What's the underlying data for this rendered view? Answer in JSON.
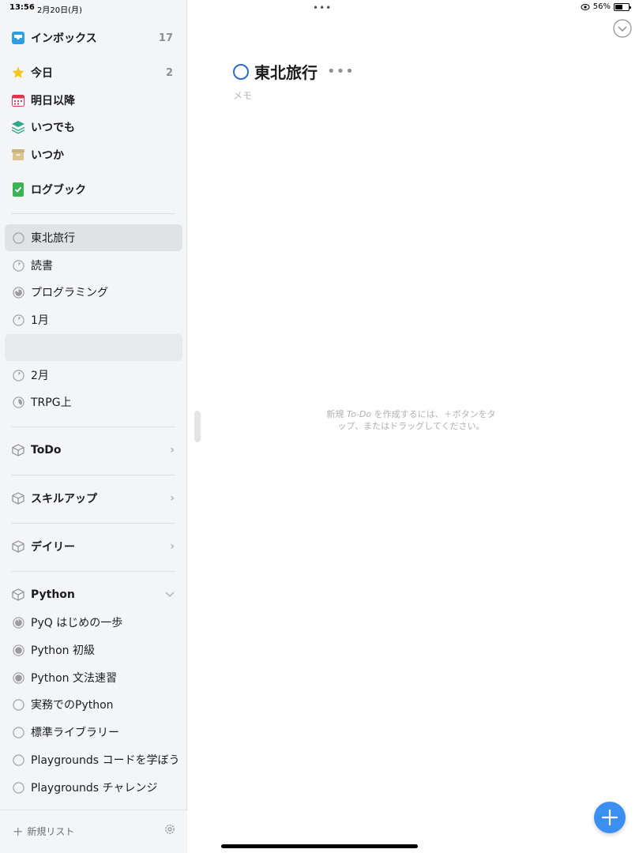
{
  "status": {
    "time": "13:56",
    "date": "2月20日(月)",
    "battery_percent": "56%",
    "battery_level": 0.56
  },
  "colors": {
    "accent": "#3b8ff0",
    "title_circle": "#2a6bd1",
    "inbox": "#2d9ee0",
    "today": "#f5c51c",
    "upcoming": "#e0344c",
    "anytime": "#2fa88a",
    "someday": "#c9b27a",
    "logbook": "#3ab255"
  },
  "sidebar": {
    "smart_lists": [
      {
        "label": "インボックス",
        "count": "17",
        "icon": "inbox-icon"
      },
      {
        "label": "今日",
        "count": "2",
        "icon": "star-icon"
      },
      {
        "label": "明日以降",
        "count": "",
        "icon": "calendar-icon"
      },
      {
        "label": "いつでも",
        "count": "",
        "icon": "layers-icon"
      },
      {
        "label": "いつか",
        "count": "",
        "icon": "archive-box-icon"
      },
      {
        "label": "ログブック",
        "count": "",
        "icon": "logbook-icon"
      }
    ],
    "projects": [
      {
        "label": "東北旅行",
        "progress": 0
      },
      {
        "label": "読書",
        "progress": 0.1
      },
      {
        "label": "プログラミング",
        "progress": 0.85
      },
      {
        "label": "1月",
        "progress": 0.1
      },
      {
        "label": "",
        "progress": 0
      },
      {
        "label": "2月",
        "progress": 0.1
      },
      {
        "label": "TRPG上",
        "progress": 0.4
      }
    ],
    "areas": [
      {
        "label": "ToDo"
      },
      {
        "label": "スキルアップ"
      },
      {
        "label": "デイリー"
      },
      {
        "label": "Python"
      }
    ],
    "python_projects": [
      {
        "label": "PyQ はじめの一歩",
        "progress": 0.95
      },
      {
        "label": "Python 初級",
        "progress": 1
      },
      {
        "label": "Python 文法速習",
        "progress": 1
      },
      {
        "label": "実務でのPython",
        "progress": 0
      },
      {
        "label": "標準ライブラリー",
        "progress": 0
      },
      {
        "label": "Playgrounds コードを学ぼう",
        "progress": 0
      },
      {
        "label": "Playgrounds チャレンジ",
        "progress": 0
      }
    ],
    "new_list_label": "新規リスト"
  },
  "main": {
    "title": "東北旅行",
    "notes_placeholder": "メモ",
    "empty_hint_line1": "新規 ",
    "empty_hint_todo": "To-Do",
    "empty_hint_line2": " を作成するには、＋ボタンをタップ、またはドラッグしてください。"
  }
}
